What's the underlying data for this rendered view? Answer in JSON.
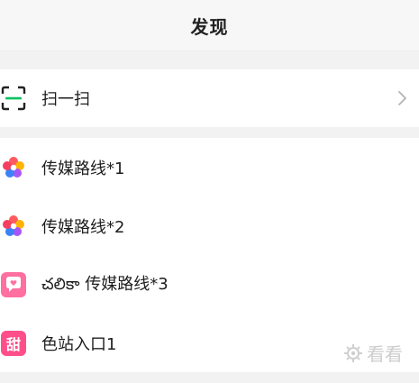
{
  "header": {
    "title": "发现"
  },
  "scan": {
    "label": "扫一扫",
    "icon": "scan-icon",
    "accent": "#07c160"
  },
  "apps": [
    {
      "label": "传媒路线*1",
      "icon": "flower-app-icon"
    },
    {
      "label": "传媒路线*2",
      "icon": "flower-app-icon"
    },
    {
      "prefix": "చలికా",
      "label": "传媒路线*3",
      "icon": "chat-bubble-app-icon"
    },
    {
      "label": "色站入口1",
      "icon": "sweet-app-icon",
      "icon_text": "甜"
    }
  ],
  "watermark": {
    "text": "看看",
    "icon": "gear-icon"
  },
  "colors": {
    "background": "#f2f2f2",
    "card": "#ffffff",
    "scan_green": "#07c160",
    "icon_pink": "#ff4f8a"
  }
}
